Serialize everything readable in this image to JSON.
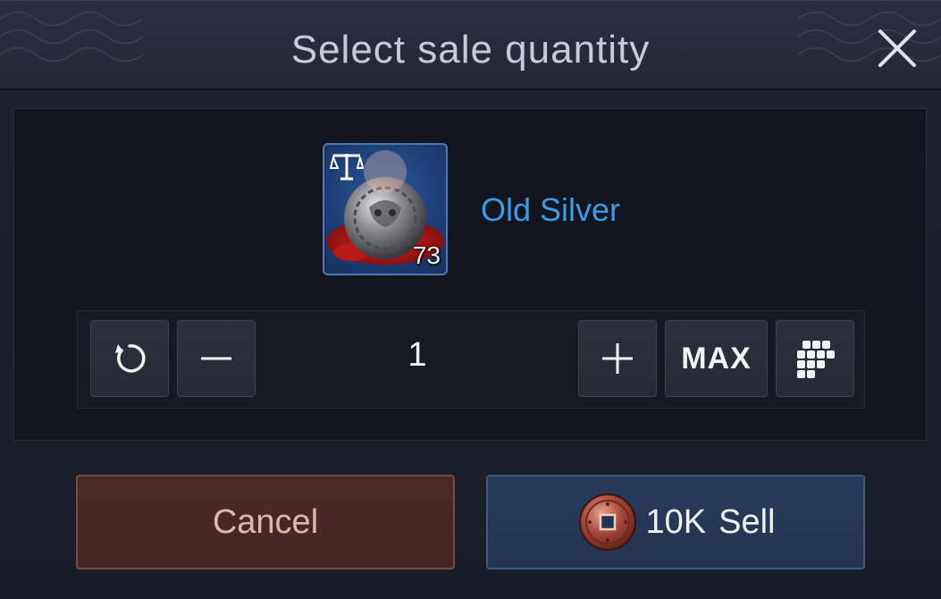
{
  "dialog": {
    "title": "Select sale quantity"
  },
  "item": {
    "name": "Old Silver",
    "count": "73",
    "icon": "silver-coin-icon"
  },
  "quantity": {
    "value": "1",
    "max_label": "MAX"
  },
  "actions": {
    "cancel_label": "Cancel",
    "sell_amount": "10K",
    "sell_label": "Sell"
  },
  "colors": {
    "item_name": "#3a9be6",
    "cancel_bg": "#4b2a28",
    "sell_bg": "#293b5c"
  }
}
